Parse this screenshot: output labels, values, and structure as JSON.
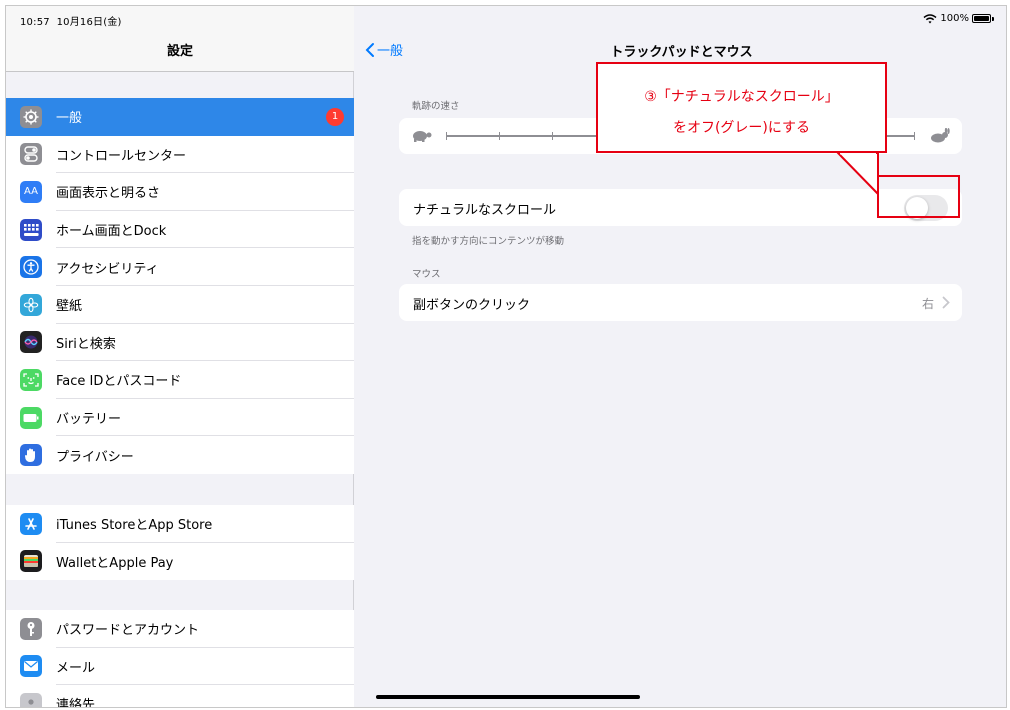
{
  "status": {
    "time": "10:57",
    "date": "10月16日(金)",
    "battery": "100%"
  },
  "sidebar": {
    "title": "設定",
    "groups": [
      {
        "items": [
          {
            "label": "一般",
            "icon": "gear-icon",
            "color": "#8e8e93",
            "selected": true,
            "badge": "1"
          },
          {
            "label": "コントロールセンター",
            "icon": "toggles-icon",
            "color": "#8e8e93"
          },
          {
            "label": "画面表示と明るさ",
            "icon": "aa-icon",
            "color": "#2f7df6",
            "glyph": "AA"
          },
          {
            "label": "ホーム画面とDock",
            "icon": "grid-icon",
            "color": "#2f4cc8"
          },
          {
            "label": "アクセシビリティ",
            "icon": "accessibility-icon",
            "color": "#1a74e8"
          },
          {
            "label": "壁紙",
            "icon": "flower-icon",
            "color": "#33a7d9"
          },
          {
            "label": "Siriと検索",
            "icon": "siri-icon",
            "color": "#222222"
          },
          {
            "label": "Face IDとパスコード",
            "icon": "faceid-icon",
            "color": "#4cd964"
          },
          {
            "label": "バッテリー",
            "icon": "battery-icon",
            "color": "#4cd964"
          },
          {
            "label": "プライバシー",
            "icon": "hand-icon",
            "color": "#2f6ee0"
          }
        ]
      },
      {
        "items": [
          {
            "label": "iTunes StoreとApp Store",
            "icon": "appstore-icon",
            "color": "#1e8cf2"
          },
          {
            "label": "WalletとApple Pay",
            "icon": "wallet-icon",
            "color": "#1c1c1e"
          }
        ]
      },
      {
        "items": [
          {
            "label": "パスワードとアカウント",
            "icon": "key-icon",
            "color": "#8e8e93"
          },
          {
            "label": "メール",
            "icon": "mail-icon",
            "color": "#1e8cf2"
          },
          {
            "label": "連絡先",
            "icon": "contacts-icon",
            "color": "#c7c7cc"
          }
        ]
      }
    ]
  },
  "detail": {
    "back_label": "一般",
    "title": "トラックパッドとマウス",
    "tracking_section_label": "軌跡の速さ",
    "natural_scroll_label": "ナチュラルなスクロール",
    "natural_scroll_on": false,
    "natural_scroll_footer": "指を動かす方向にコンテンツが移動",
    "mouse_section_label": "マウス",
    "secondary_click_label": "副ボタンのクリック",
    "secondary_click_value": "右"
  },
  "annotation": {
    "line1": "③「ナチュラルなスクロール」",
    "line2": "をオフ(グレー)にする",
    "color": "#e60012"
  }
}
